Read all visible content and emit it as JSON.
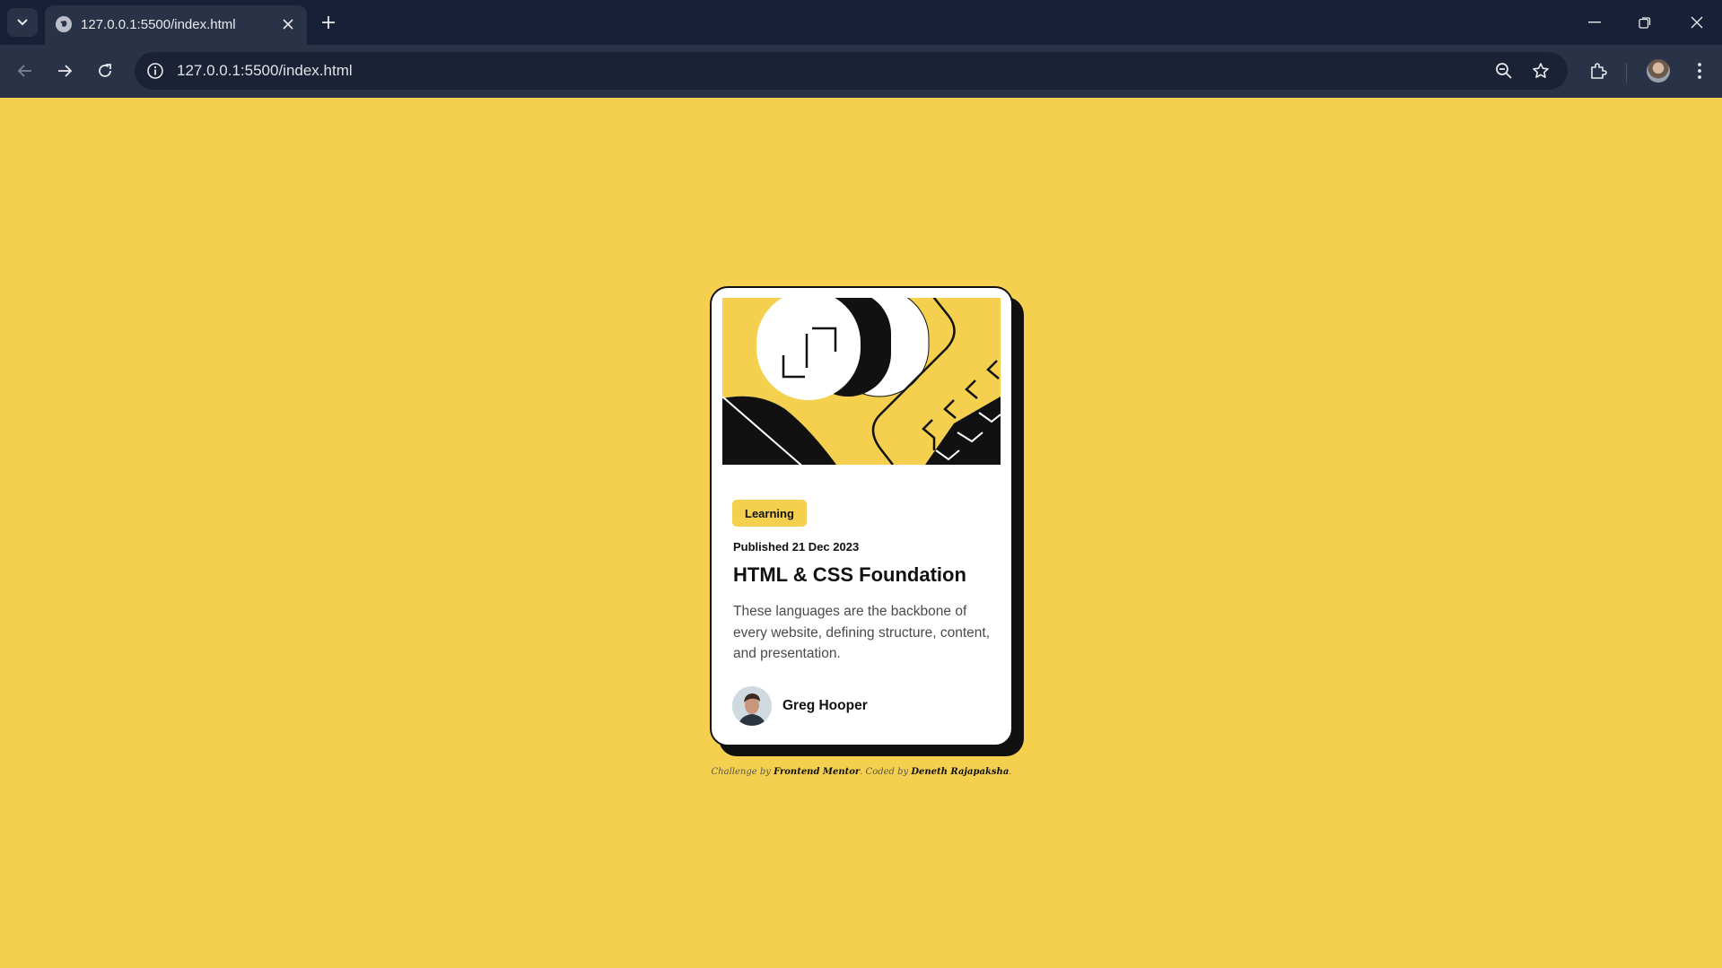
{
  "browser": {
    "tab_title": "127.0.0.1:5500/index.html",
    "url": "127.0.0.1:5500/index.html",
    "colors": {
      "frame": "#172036",
      "toolbar": "#2a3248",
      "omnibox": "#1b2235"
    },
    "icons": [
      "tab-list-icon",
      "globe-icon",
      "close-icon",
      "plus-icon",
      "minimize-icon",
      "restore-icon",
      "window-close-icon",
      "back-icon",
      "forward-icon",
      "reload-icon",
      "info-icon",
      "zoom-icon",
      "star-icon",
      "extensions-icon",
      "profile-icon",
      "menu-icon"
    ]
  },
  "page": {
    "background": "#f4d04e",
    "card": {
      "badge": "Learning",
      "published": "Published 21 Dec 2023",
      "title": "HTML & CSS Foundation",
      "description": "These languages are the backbone of every website, defining structure, content, and presentation.",
      "author": "Greg Hooper"
    },
    "attribution": {
      "prefix": "Challenge by",
      "source": "Frontend Mentor",
      "middle": ". Coded by",
      "coder": "Deneth Rajapaksha",
      "suffix": "."
    }
  }
}
